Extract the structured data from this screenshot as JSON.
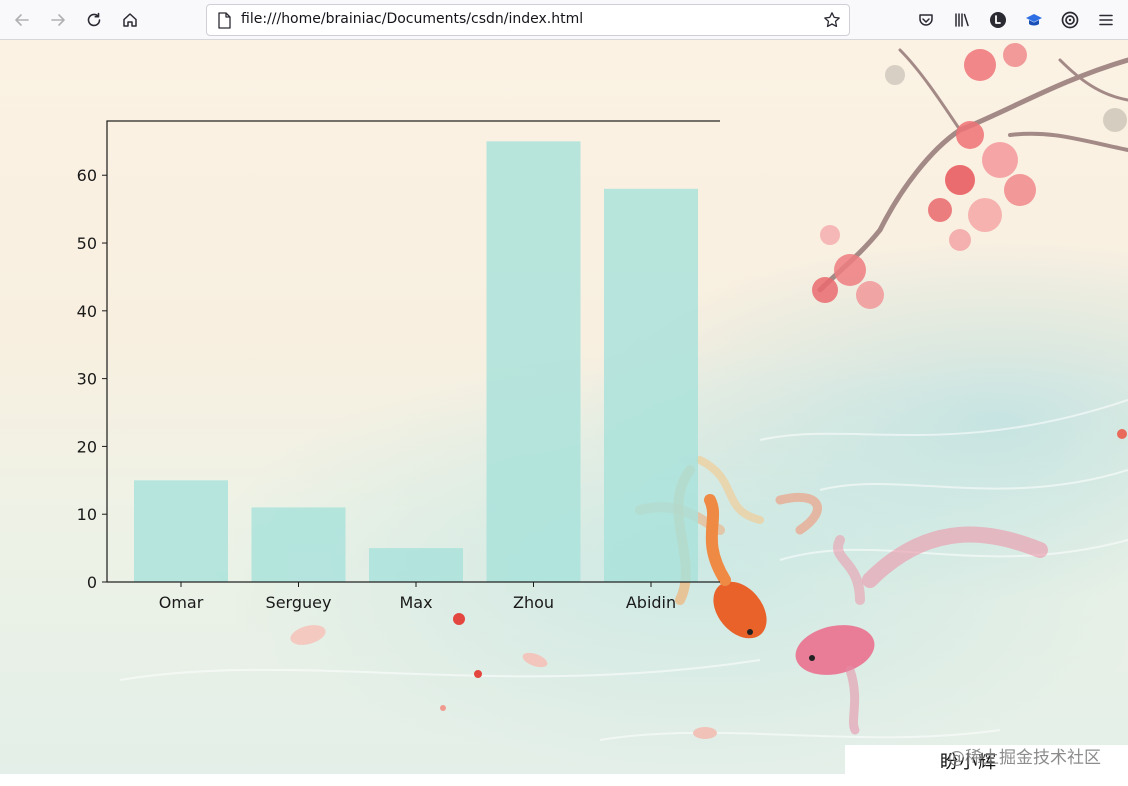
{
  "browser": {
    "url": "file:///home/brainiac/Documents/csdn/index.html"
  },
  "chart_data": {
    "type": "bar",
    "categories": [
      "Omar",
      "Serguey",
      "Max",
      "Zhou",
      "Abidin"
    ],
    "values": [
      15,
      11,
      5,
      65,
      58
    ],
    "yticks": [
      0,
      10,
      20,
      30,
      40,
      50,
      60
    ],
    "ylim": [
      0,
      68
    ],
    "bar_color": "#a8e2da",
    "grid": false
  },
  "watermark": {
    "signature": "盼小辉",
    "text": "@稀土掘金技术社区"
  },
  "colors": {
    "petal": "#ea6f73",
    "fish_orange": "#e8622a",
    "fish_pink": "#e97c97"
  }
}
